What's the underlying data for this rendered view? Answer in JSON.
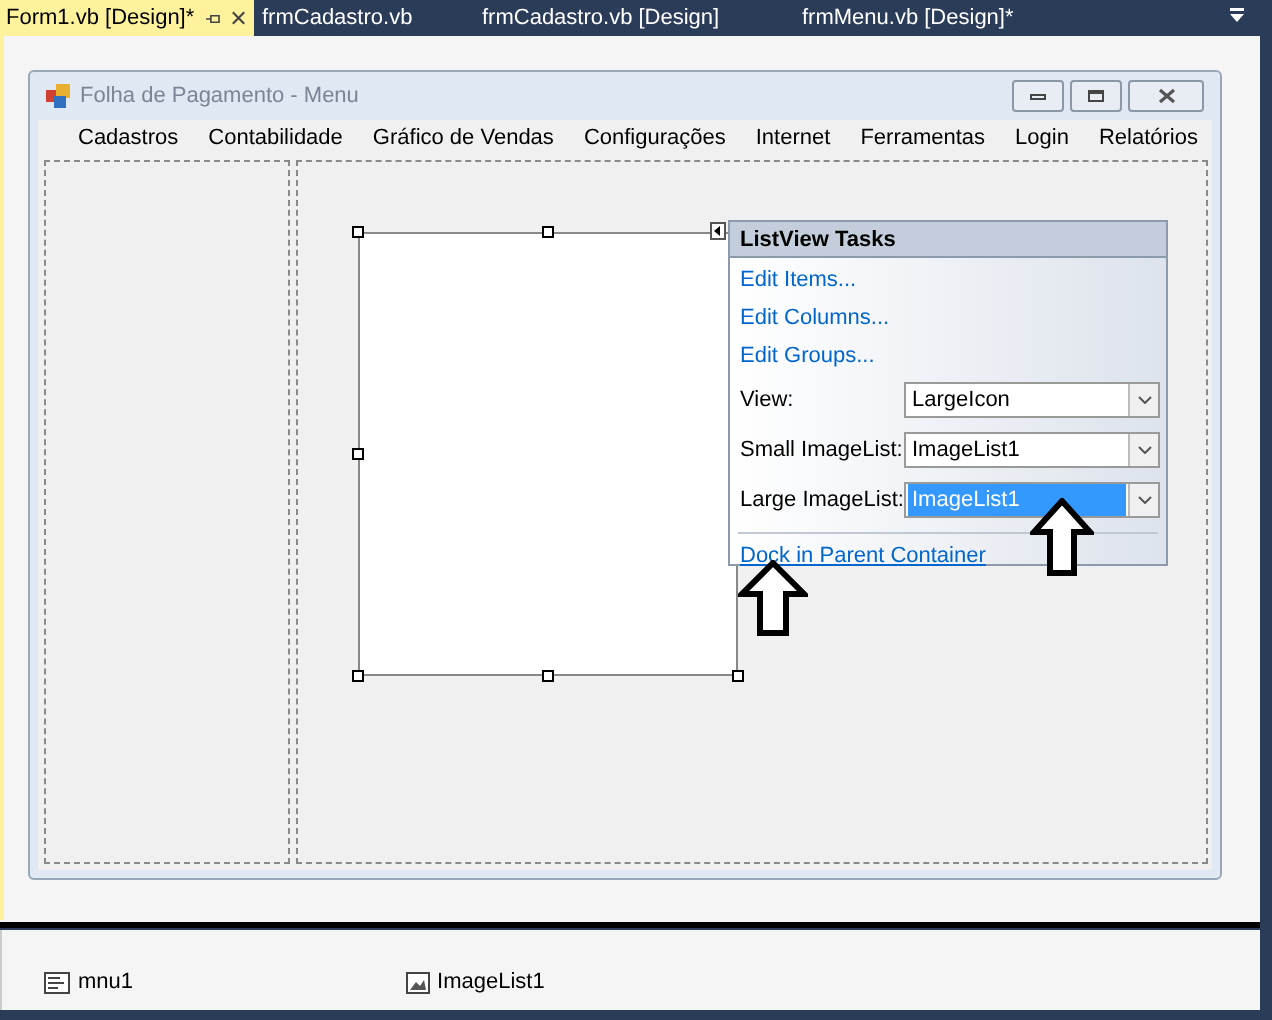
{
  "tabs": [
    {
      "label": "Form1.vb [Design]*",
      "selected": true
    },
    {
      "label": "frmCadastro.vb",
      "selected": false
    },
    {
      "label": "frmCadastro.vb [Design]",
      "selected": false
    },
    {
      "label": "frmMenu.vb [Design]*",
      "selected": false
    }
  ],
  "form": {
    "title": "Folha de Pagamento - Menu",
    "menu": [
      "Cadastros",
      "Contabilidade",
      "Gráfico de Vendas",
      "Configurações",
      "Internet",
      "Ferramentas",
      "Login",
      "Relatórios"
    ]
  },
  "listview_tasks": {
    "title": "ListView Tasks",
    "links": [
      "Edit Items...",
      "Edit Columns...",
      "Edit Groups..."
    ],
    "fields": [
      {
        "label": "View:",
        "value": "LargeIcon",
        "selected": false
      },
      {
        "label": "Small ImageList:",
        "value": "ImageList1",
        "selected": false
      },
      {
        "label": "Large ImageList:",
        "value": "ImageList1",
        "selected": true
      }
    ],
    "dock_link": "Dock in Parent Container"
  },
  "tray": [
    {
      "label": "mnu1",
      "kind": "menu"
    },
    {
      "label": "ImageList1",
      "kind": "imagelist"
    }
  ]
}
